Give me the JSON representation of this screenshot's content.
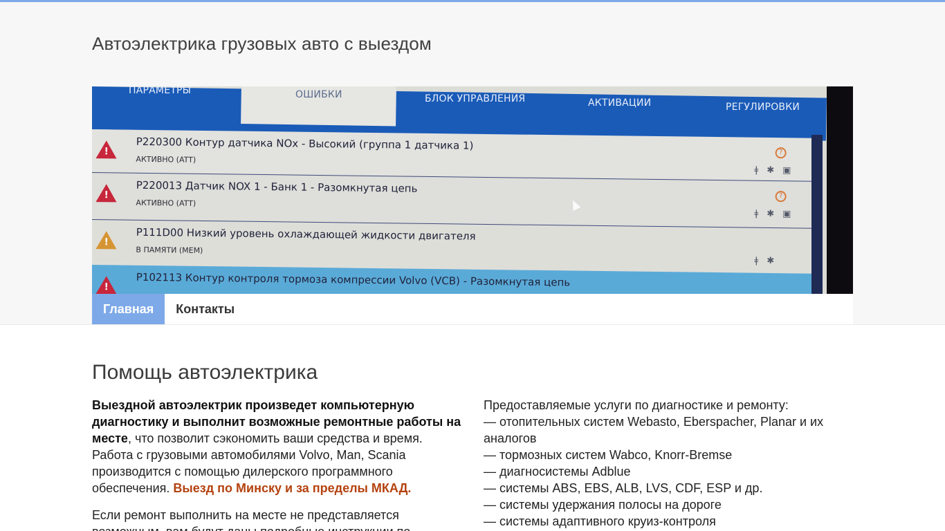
{
  "site": {
    "title": "Автоэлектрика грузовых авто с выездом"
  },
  "hero": {
    "tabs": [
      "ПАРАМЕТРЫ",
      "ОШИБКИ",
      "БЛОК УПРАВЛЕНИЯ",
      "АКТИВАЦИИ",
      "РЕГУЛИРОВКИ"
    ],
    "faults": [
      {
        "code": "P220300 Контур датчика NOx - Высокий (группа 1 датчика 1)",
        "status": "АКТИВНО (ATT)",
        "severity": "red"
      },
      {
        "code": "P220013 Датчик NOX 1 - Банк 1 - Разомкнутая цепь",
        "status": "АКТИВНО (ATT)",
        "severity": "red"
      },
      {
        "code": "P111D00 Низкий уровень охлаждающей жидкости двигателя",
        "status": "В ПАМЯТИ (MEM)",
        "severity": "amber"
      },
      {
        "code": "P102113 Контур контроля тормоза компрессии Volvo (VCB) - Разомкнутая цепь",
        "status": "",
        "severity": "red"
      }
    ],
    "colors": {
      "tab_bar": "#1a5bb8",
      "warning_red": "#c7263b",
      "warning_amber": "#d69433"
    }
  },
  "nav": {
    "items": [
      {
        "label": "Главная",
        "active": true
      },
      {
        "label": "Контакты",
        "active": false
      }
    ],
    "active_color": "#7ea9e8"
  },
  "main": {
    "heading": "Помощь автоэлектрика",
    "left": {
      "intro_bold": "Выездной автоэлектрик произведет компьютерную диагностику и выполнит возможные ремонтные работы на месте",
      "intro_rest": ", что позволит сэкономить ваши средства и время. Работа с грузовыми автомобилями Volvo, Man, Scania производится с помощью дилерского программного обеспечения. ",
      "intro_accent": "Выезд по Минску и за пределы МКАД.",
      "second_paragraph": "Если ремонт выполнить на месте не представляется возможным, вам будут даны подробные инструкции по"
    },
    "right": {
      "lead": "Предоставляемые услуги по диагностике и ремонту:",
      "services": [
        "— отопительных систем Webasto, Eberspacher, Planar и их аналогов",
        "— тормозных систем Wabco, Knorr-Bremse",
        "— диагносистемы Adblue",
        "— системы ABS, EBS, ALB, LVS, CDF, ESP и др.",
        "— системы удержания полосы на дороге",
        "— системы адаптивного круиз-контроля"
      ]
    },
    "accent_color": "#b4420f"
  }
}
